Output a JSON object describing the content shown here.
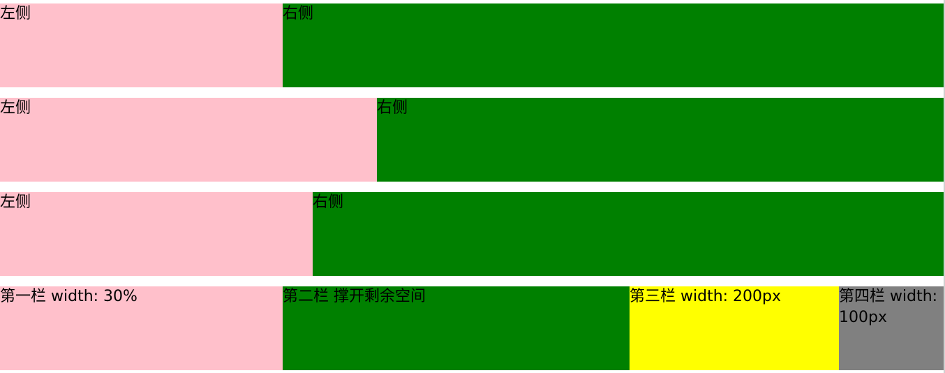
{
  "rows": [
    {
      "left": "左侧",
      "right": "右侧"
    },
    {
      "left": "左侧",
      "right": "右侧"
    },
    {
      "left": "左侧",
      "right": "右侧"
    }
  ],
  "columns": [
    {
      "label": "第一栏 width: 30%"
    },
    {
      "label": "第二栏 撑开剩余空间"
    },
    {
      "label": "第三栏 width: 200px"
    },
    {
      "label": "第四栏 width: 100px"
    }
  ],
  "colors": {
    "pink": "#ffc0cb",
    "green": "#008000",
    "yellow": "#ffff00",
    "gray": "#808080"
  }
}
